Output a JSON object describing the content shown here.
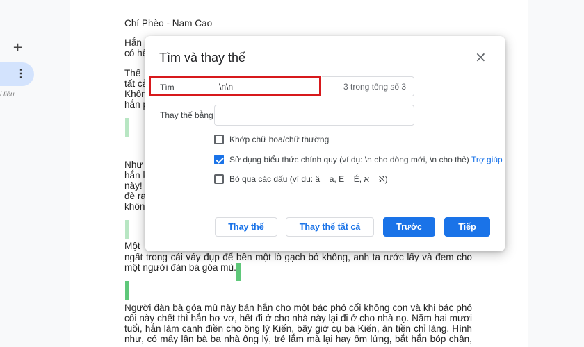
{
  "sidebar": {
    "plus_icon": "+",
    "more_icon": "⋮",
    "label_fragment": "i liệu"
  },
  "document": {
    "title": "Chí Phèo -  Nam Cao",
    "lines": [
      "Hắn",
      "có hề",
      "Thế",
      "tất cả",
      "Khôn",
      "hắn p",
      "Như",
      "hắn k",
      "này!",
      "đè ra",
      "khôn",
      "Một",
      "ngất trong cái váy đụp để bên một lò gạch bỏ không, anh ta rước lấy và đem cho",
      "một người đàn bà góa mù.",
      "Người đàn bà góa mù này bán hắn cho một bác phó cối không con và khi bác phó",
      "cối này chết thì hắn bơ vơ, hết đi ở cho nhà này lại đi ở cho nhà nọ. Năm hai mươi",
      "tuổi, hắn làm canh điền cho ông lý Kiến, bây giờ cụ bá Kiến, ăn tiền chỉ làng. Hình",
      "như, có mấy lần bà ba nhà ông lý, trẻ lắm mà lại hay ốm lửng, bắt hắn bóp chân,"
    ]
  },
  "dialog": {
    "title": "Tìm và thay thế",
    "close_icon": "×",
    "find_label": "Tìm",
    "find_value": "\\n\\n",
    "find_count": "3 trong tổng số 3",
    "replace_label": "Thay thế bằng",
    "replace_value": "",
    "options": [
      {
        "label": "Khớp chữ hoa/chữ thường",
        "checked": false
      },
      {
        "label": "Sử dụng biểu thức chính quy (ví dụ: \\n cho dòng mới, \\n cho thẻ)",
        "checked": true,
        "help": "Trợ giúp"
      },
      {
        "label": "Bỏ qua các dấu (ví dụ: ä = a, E = É, א = ℵ)",
        "checked": false
      }
    ],
    "buttons": {
      "replace": "Thay thế",
      "replace_all": "Thay thế tất cả",
      "prev": "Trước",
      "next": "Tiếp"
    }
  },
  "colors": {
    "accent": "#1a73e8",
    "highlight": "#d7191c",
    "match_mark": "#5fc87a"
  }
}
